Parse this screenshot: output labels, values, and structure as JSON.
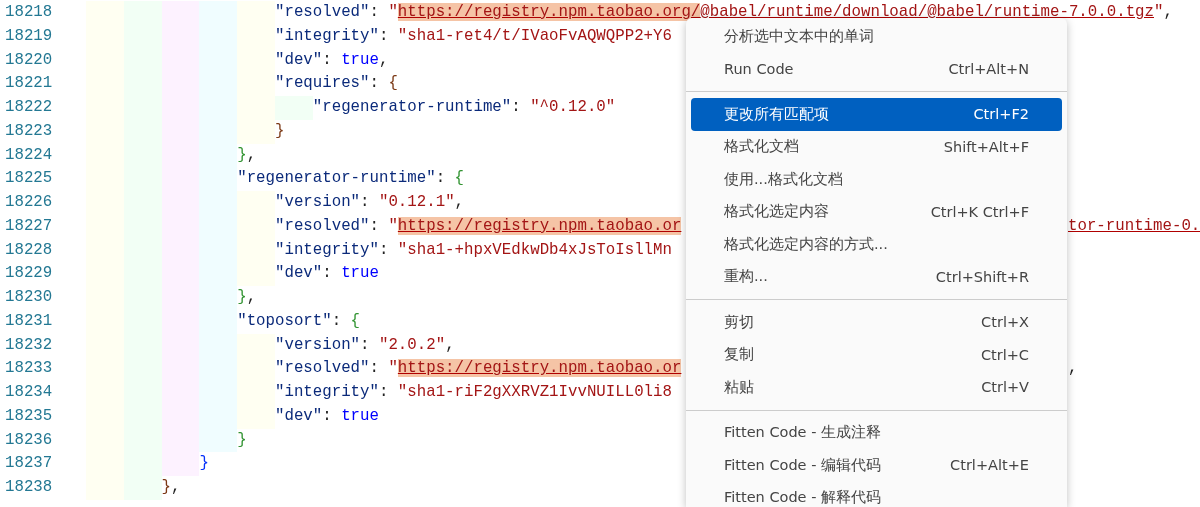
{
  "editor": {
    "lines": [
      {
        "children": [
          {
            "children": [
              {
                "children": [
                  {
                    "children": [
                      {
                        "children": [
                          {
                            "number": "18218",
                            "tokens": [
                              {
                                "kind": "key",
                                "text": "\"resolved\""
                              },
                              {
                                "kind": "punct",
                                "text": ": "
                              },
                              {
                                "kind": "string",
                                "text": "\""
                              },
                              {
                                "kind": "match",
                                "text": "https://registry.npm.taobao.org/"
                              },
                              {
                                "kind": "link",
                                "text": "@babel/runtime/download/@babel/runtime-7.0.0.tgz"
                              },
                              {
                                "kind": "string",
                                "text": "\""
                              },
                              {
                                "kind": "punct",
                                "text": ","
                              }
                            ]
                          },
                          {
                            "number": "18219",
                            "tokens": [
                              {
                                "kind": "key",
                                "text": "\"integrity\""
                              },
                              {
                                "kind": "punct",
                                "text": ": "
                              },
                              {
                                "kind": "string",
                                "text": "\"sha1-ret4/t/IVaoFvAQWQPP2+Y6"
                              }
                            ]
                          },
                          {
                            "number": "18220",
                            "tokens": [
                              {
                                "kind": "key",
                                "text": "\"dev\""
                              },
                              {
                                "kind": "punct",
                                "text": ": "
                              },
                              {
                                "kind": "bool",
                                "text": "true"
                              },
                              {
                                "kind": "punct",
                                "text": ","
                              }
                            ]
                          },
                          {
                            "number": "18221",
                            "tokens": [
                              {
                                "kind": "key",
                                "text": "\"requires\""
                              },
                              {
                                "kind": "punct",
                                "text": ": "
                              },
                              {
                                "kind": "brace",
                                "text": "{",
                                "color": "#7b3814"
                              }
                            ]
                          },
                          {
                            "children": [
                              {
                                "number": "18222",
                                "tokens": [
                                  {
                                    "kind": "key",
                                    "text": "\"regenerator-runtime\""
                                  },
                                  {
                                    "kind": "punct",
                                    "text": ": "
                                  },
                                  {
                                    "kind": "string",
                                    "text": "\"^0.12.0\""
                                  }
                                ]
                              }
                            ]
                          },
                          {
                            "number": "18223",
                            "tokens": [
                              {
                                "kind": "brace",
                                "text": "}",
                                "color": "#7b3814"
                              }
                            ]
                          }
                        ]
                      },
                      {
                        "number": "18224",
                        "tokens": [
                          {
                            "kind": "brace",
                            "text": "}",
                            "color": "#319331"
                          },
                          {
                            "kind": "punct",
                            "text": ","
                          }
                        ]
                      },
                      {
                        "number": "18225",
                        "tokens": [
                          {
                            "kind": "key",
                            "text": "\"regenerator-runtime\""
                          },
                          {
                            "kind": "punct",
                            "text": ": "
                          },
                          {
                            "kind": "brace",
                            "text": "{",
                            "color": "#319331"
                          }
                        ]
                      },
                      {
                        "children": [
                          {
                            "number": "18226",
                            "tokens": [
                              {
                                "kind": "key",
                                "text": "\"version\""
                              },
                              {
                                "kind": "punct",
                                "text": ": "
                              },
                              {
                                "kind": "string",
                                "text": "\"0.12.1\""
                              },
                              {
                                "kind": "punct",
                                "text": ","
                              }
                            ]
                          },
                          {
                            "number": "18227",
                            "tokens": [
                              {
                                "kind": "key",
                                "text": "\"resolved\""
                              },
                              {
                                "kind": "punct",
                                "text": ": "
                              },
                              {
                                "kind": "string",
                                "text": "\""
                              },
                              {
                                "kind": "match",
                                "text": "https://registry.npm.taobao.or"
                              }
                            ],
                            "tail": [
                              {
                                "kind": "link",
                                "text": "tor-runtime-0."
                              }
                            ]
                          },
                          {
                            "number": "18228",
                            "tokens": [
                              {
                                "kind": "key",
                                "text": "\"integrity\""
                              },
                              {
                                "kind": "punct",
                                "text": ": "
                              },
                              {
                                "kind": "string",
                                "text": "\"sha1-+hpxVEdkwDb4xJsToIsllMn"
                              }
                            ]
                          },
                          {
                            "number": "18229",
                            "tokens": [
                              {
                                "kind": "key",
                                "text": "\"dev\""
                              },
                              {
                                "kind": "punct",
                                "text": ": "
                              },
                              {
                                "kind": "bool",
                                "text": "true"
                              }
                            ]
                          }
                        ]
                      },
                      {
                        "number": "18230",
                        "tokens": [
                          {
                            "kind": "brace",
                            "text": "}",
                            "color": "#319331"
                          },
                          {
                            "kind": "punct",
                            "text": ","
                          }
                        ]
                      },
                      {
                        "number": "18231",
                        "tokens": [
                          {
                            "kind": "key",
                            "text": "\"toposort\""
                          },
                          {
                            "kind": "punct",
                            "text": ": "
                          },
                          {
                            "kind": "brace",
                            "text": "{",
                            "color": "#319331"
                          }
                        ]
                      },
                      {
                        "children": [
                          {
                            "number": "18232",
                            "tokens": [
                              {
                                "kind": "key",
                                "text": "\"version\""
                              },
                              {
                                "kind": "punct",
                                "text": ": "
                              },
                              {
                                "kind": "string",
                                "text": "\"2.0.2\""
                              },
                              {
                                "kind": "punct",
                                "text": ","
                              }
                            ]
                          },
                          {
                            "number": "18233",
                            "tokens": [
                              {
                                "kind": "key",
                                "text": "\"resolved\""
                              },
                              {
                                "kind": "punct",
                                "text": ": "
                              },
                              {
                                "kind": "string",
                                "text": "\""
                              },
                              {
                                "kind": "match",
                                "text": "https://registry.npm.taobao.or"
                              }
                            ],
                            "tail": [
                              {
                                "kind": "punct",
                                "text": ","
                              }
                            ]
                          },
                          {
                            "number": "18234",
                            "tokens": [
                              {
                                "kind": "key",
                                "text": "\"integrity\""
                              },
                              {
                                "kind": "punct",
                                "text": ": "
                              },
                              {
                                "kind": "string",
                                "text": "\"sha1-riF2gXXRVZ1IvvNUILL0li8"
                              }
                            ]
                          },
                          {
                            "number": "18235",
                            "tokens": [
                              {
                                "kind": "key",
                                "text": "\"dev\""
                              },
                              {
                                "kind": "punct",
                                "text": ": "
                              },
                              {
                                "kind": "bool",
                                "text": "true"
                              }
                            ]
                          }
                        ]
                      },
                      {
                        "number": "18236",
                        "tokens": [
                          {
                            "kind": "brace",
                            "text": "}",
                            "color": "#319331"
                          }
                        ]
                      }
                    ]
                  },
                  {
                    "number": "18237",
                    "tokens": [
                      {
                        "kind": "brace",
                        "text": "}",
                        "color": "#0431fa"
                      }
                    ]
                  }
                ]
              },
              {
                "number": "18238",
                "tokens": [
                  {
                    "kind": "brace",
                    "text": "}",
                    "color": "#7b3814"
                  },
                  {
                    "kind": "punct",
                    "text": ","
                  }
                ]
              }
            ]
          }
        ]
      }
    ]
  },
  "context_menu": {
    "items": [
      {
        "kind": "item",
        "label": "分析选中文本中的单词",
        "selected": false
      },
      {
        "kind": "item",
        "label": "Run Code",
        "shortcut": "Ctrl+Alt+N",
        "selected": false
      },
      {
        "kind": "separator"
      },
      {
        "kind": "item",
        "label": "更改所有匹配项",
        "shortcut": "Ctrl+F2",
        "selected": true
      },
      {
        "kind": "item",
        "label": "格式化文档",
        "shortcut": "Shift+Alt+F",
        "selected": false
      },
      {
        "kind": "item",
        "label": "使用...格式化文档",
        "selected": false
      },
      {
        "kind": "item",
        "label": "格式化选定内容",
        "shortcut": "Ctrl+K Ctrl+F",
        "selected": false
      },
      {
        "kind": "item",
        "label": "格式化选定内容的方式...",
        "selected": false
      },
      {
        "kind": "item",
        "label": "重构...",
        "shortcut": "Ctrl+Shift+R",
        "selected": false
      },
      {
        "kind": "separator"
      },
      {
        "kind": "item",
        "label": "剪切",
        "shortcut": "Ctrl+X",
        "selected": false
      },
      {
        "kind": "item",
        "label": "复制",
        "shortcut": "Ctrl+C",
        "selected": false
      },
      {
        "kind": "item",
        "label": "粘贴",
        "shortcut": "Ctrl+V",
        "selected": false
      },
      {
        "kind": "separator"
      },
      {
        "kind": "item",
        "label": "Fitten Code - 生成注释",
        "selected": false
      },
      {
        "kind": "item",
        "label": "Fitten Code - 编辑代码",
        "shortcut": "Ctrl+Alt+E",
        "selected": false
      },
      {
        "kind": "item",
        "label": "Fitten Code - 解释代码",
        "selected": false
      }
    ]
  }
}
